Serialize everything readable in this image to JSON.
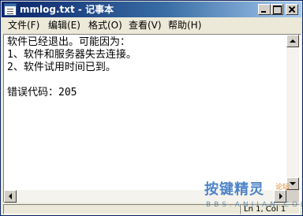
{
  "window": {
    "title": "mmlog.txt - 记事本",
    "icon": "notepad-icon"
  },
  "title_buttons": {
    "minimize_icon": "minimize-icon",
    "maximize_icon": "maximize-icon",
    "close_icon": "close-icon"
  },
  "menu": {
    "items": [
      {
        "label": "文件(F)"
      },
      {
        "label": "编辑(E)"
      },
      {
        "label": "格式(O)"
      },
      {
        "label": "查看(V)"
      },
      {
        "label": "帮助(H)"
      }
    ]
  },
  "document": {
    "lines": [
      "软件已经退出。可能因为：",
      "1、软件和服务器失去连接。",
      "2、软件试用时间已到。",
      "错误代码：205"
    ]
  },
  "status": {
    "position": "Ln 1, Col 1"
  },
  "watermark": {
    "main": "按键精灵",
    "tag": "论坛",
    "sub": "BBS.ANJIAN.COM"
  }
}
